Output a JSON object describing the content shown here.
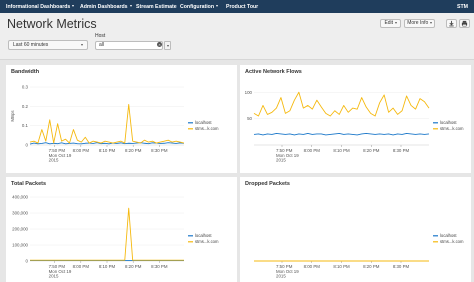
{
  "nav": {
    "items": [
      {
        "label": "Informational Dashboards",
        "dropdown": true
      },
      {
        "label": "Admin Dashboards",
        "dropdown": true
      },
      {
        "label": "Stream Estimate",
        "dropdown": false
      },
      {
        "label": "Configuration",
        "dropdown": true
      },
      {
        "label": "Product Tour",
        "dropdown": false
      }
    ],
    "user": "STM",
    "bg_color": "#1f3d5c"
  },
  "header": {
    "title": "Network Metrics",
    "edit_label": "Edit",
    "more_info_label": "More Info",
    "download_icon": "download-icon",
    "print_icon": "print-icon"
  },
  "filters": {
    "time_range": "Last 60 minutes",
    "host_label": "Host",
    "host_value": "all"
  },
  "colors": {
    "localhost": "#1a77c9",
    "other_host": "#f5b90f"
  },
  "chart_data": [
    {
      "type": "line",
      "title": "Bandwidth",
      "ylabel": "MBps",
      "ylim": [
        0,
        0.3
      ],
      "y_ticks": [
        "0",
        "0.1",
        "0.2",
        "0.3"
      ],
      "x_ticks": [
        "7:50 PM\nMon Oct 19\n2015",
        "8:00 PM",
        "8:10 PM",
        "8:20 PM",
        "8:30 PM"
      ],
      "x_tick_positions": [
        0.16,
        0.33,
        0.5,
        0.67,
        0.84
      ],
      "legend": [
        "localhost",
        "stms...k.com"
      ],
      "series": [
        {
          "name": "localhost",
          "values": [
            0.005,
            0.01,
            0.006,
            0.008,
            0.012,
            0.006,
            0.009,
            0.007,
            0.011,
            0.006,
            0.008,
            0.01,
            0.007,
            0.006,
            0.009,
            0.01,
            0.008,
            0.012,
            0.007,
            0.009,
            0.006,
            0.01,
            0.008,
            0.011,
            0.007,
            0.009,
            0.008,
            0.01,
            0.012,
            0.009,
            0.007,
            0.011,
            0.01,
            0.008,
            0.009,
            0.012,
            0.01,
            0.008,
            0.011,
            0.009
          ]
        },
        {
          "name": "stms...k.com",
          "values": [
            0.015,
            0.02,
            0.01,
            0.08,
            0.02,
            0.13,
            0.01,
            0.11,
            0.02,
            0.03,
            0.01,
            0.08,
            0.025,
            0.015,
            0.04,
            0.01,
            0.02,
            0.015,
            0.01,
            0.02,
            0.015,
            0.01,
            0.015,
            0.02,
            0.01,
            0.21,
            0.02,
            0.015,
            0.01,
            0.025,
            0.015,
            0.02,
            0.01,
            0.015,
            0.02,
            0.025,
            0.015,
            0.02,
            0.015,
            0.01
          ]
        }
      ]
    },
    {
      "type": "line",
      "title": "Active Network Flows",
      "ylim": [
        0,
        110
      ],
      "y_ticks": [
        "50",
        "100"
      ],
      "x_ticks": [
        "7:50 PM\nMon Oct 19\n2015",
        "8:00 PM",
        "8:10 PM",
        "8:20 PM",
        "8:30 PM"
      ],
      "x_tick_positions": [
        0.16,
        0.33,
        0.5,
        0.67,
        0.84
      ],
      "legend": [
        "localhost",
        "stms...k.com"
      ],
      "series": [
        {
          "name": "localhost",
          "values": [
            20,
            21,
            19,
            21,
            20,
            22,
            21,
            20,
            21,
            19,
            21,
            20,
            22,
            20,
            21,
            21,
            19,
            20,
            21,
            22,
            20,
            21,
            20,
            19,
            21,
            22,
            21,
            20,
            21,
            20,
            21,
            19,
            21,
            20,
            22,
            21,
            20,
            21,
            20,
            21
          ]
        },
        {
          "name": "stms...k.com",
          "values": [
            60,
            55,
            75,
            58,
            62,
            70,
            90,
            60,
            65,
            85,
            100,
            70,
            75,
            68,
            85,
            72,
            60,
            55,
            65,
            58,
            75,
            62,
            70,
            68,
            90,
            72,
            60,
            55,
            80,
            95,
            62,
            70,
            58,
            65,
            93,
            75,
            68,
            88,
            82,
            70
          ]
        }
      ]
    },
    {
      "type": "line",
      "title": "Total Packets",
      "ylim": [
        0,
        400000
      ],
      "y_ticks": [
        "0",
        "100,000",
        "200,000",
        "300,000",
        "400,000"
      ],
      "x_ticks": [
        "7:50 PM\nMon Oct 19\n2015",
        "8:00 PM",
        "8:10 PM",
        "8:20 PM",
        "8:30 PM"
      ],
      "x_tick_positions": [
        0.16,
        0.33,
        0.5,
        0.67,
        0.84
      ],
      "legend": [
        "localhost",
        "stms...k.com"
      ],
      "series": [
        {
          "name": "localhost",
          "values": [
            3000,
            3000,
            3000,
            3000,
            3000,
            3000,
            3000,
            3000,
            3000,
            3000,
            3000,
            3000,
            3000,
            3000,
            3000,
            3000,
            3000,
            3000,
            3000,
            3000,
            3000,
            3000,
            3000,
            3000,
            3000,
            3000,
            3000,
            3000,
            3000,
            3000,
            3000,
            3000,
            3000,
            3000,
            3000,
            3000,
            3000,
            3000,
            3000,
            3000
          ]
        },
        {
          "name": "stms...k.com",
          "values": [
            5000,
            5000,
            5000,
            5000,
            5000,
            5000,
            5000,
            5000,
            5000,
            5000,
            5000,
            5000,
            5000,
            5000,
            5000,
            5000,
            5000,
            5000,
            5000,
            5000,
            5000,
            5000,
            5000,
            5000,
            5000,
            330000,
            5000,
            5000,
            5000,
            5000,
            5000,
            5000,
            5000,
            5000,
            5000,
            5000,
            5000,
            5000,
            5000,
            5000
          ]
        }
      ]
    },
    {
      "type": "line",
      "title": "Dropped Packets",
      "ylim": [
        0,
        1
      ],
      "y_ticks": [],
      "x_ticks": [
        "7:50 PM\nMon Oct 19\n2015",
        "8:00 PM",
        "8:10 PM",
        "8:20 PM",
        "8:30 PM"
      ],
      "x_tick_positions": [
        0.16,
        0.33,
        0.5,
        0.67,
        0.84
      ],
      "legend": [
        "localhost",
        "stms...k.com"
      ],
      "series": [
        {
          "name": "localhost",
          "values": [
            0,
            0,
            0,
            0,
            0,
            0,
            0,
            0,
            0,
            0,
            0,
            0,
            0,
            0,
            0,
            0,
            0,
            0,
            0,
            0,
            0,
            0,
            0,
            0,
            0,
            0,
            0,
            0,
            0,
            0,
            0,
            0,
            0,
            0,
            0,
            0,
            0,
            0,
            0,
            0
          ]
        },
        {
          "name": "stms...k.com",
          "values": [
            0,
            0,
            0,
            0,
            0,
            0,
            0,
            0,
            0,
            0,
            0,
            0,
            0,
            0,
            0,
            0,
            0,
            0,
            0,
            0,
            0,
            0,
            0,
            0,
            0,
            0,
            0,
            0,
            0,
            0,
            0,
            0,
            0,
            0,
            0,
            0,
            0,
            0,
            0,
            0
          ]
        }
      ]
    }
  ]
}
